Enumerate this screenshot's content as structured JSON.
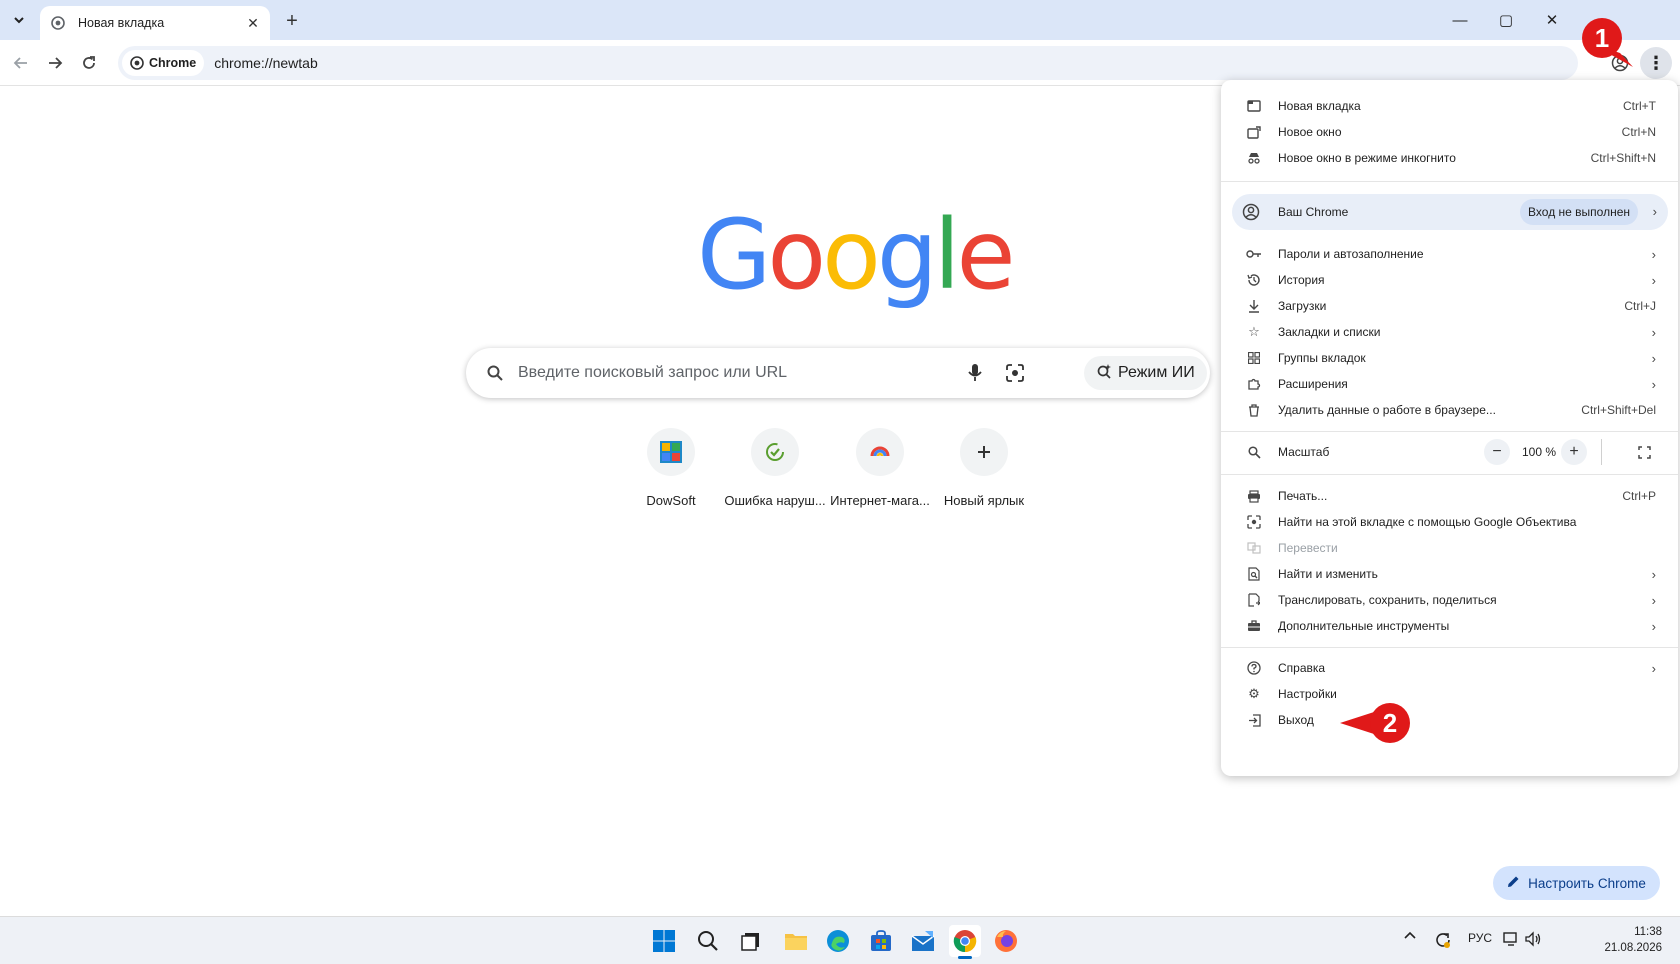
{
  "tab": {
    "title": "Новая вкладка"
  },
  "toolbar": {
    "chip_label": "Chrome",
    "url": "chrome://newtab"
  },
  "google_logo": {
    "letters": [
      "G",
      "o",
      "o",
      "g",
      "l",
      "e"
    ],
    "colors": [
      "#4285F4",
      "#EA4335",
      "#FBBC05",
      "#4285F4",
      "#34A853",
      "#EA4335"
    ]
  },
  "search": {
    "placeholder": "Введите поисковый запрос или URL",
    "ai_mode_label": "Режим ИИ"
  },
  "shortcuts": [
    {
      "label": "DowSoft",
      "icon": "dowsoft-icon"
    },
    {
      "label": "Ошибка наруш...",
      "icon": "checkmark-icon"
    },
    {
      "label": "Интернет-мага...",
      "icon": "rainbow-icon"
    },
    {
      "label": "Новый ярлык",
      "icon": "plus-icon"
    }
  ],
  "customize": {
    "label": "Настроить Chrome"
  },
  "menu": {
    "new_tab": {
      "label": "Новая вкладка",
      "shortcut": "Ctrl+T"
    },
    "new_window": {
      "label": "Новое окно",
      "shortcut": "Ctrl+N"
    },
    "incognito": {
      "label": "Новое окно в режиме инкогнито",
      "shortcut": "Ctrl+Shift+N"
    },
    "your_chrome": {
      "label": "Ваш Chrome",
      "status": "Вход не выполнен"
    },
    "passwords": {
      "label": "Пароли и автозаполнение"
    },
    "history": {
      "label": "История"
    },
    "downloads": {
      "label": "Загрузки",
      "shortcut": "Ctrl+J"
    },
    "bookmarks": {
      "label": "Закладки и списки"
    },
    "tab_groups": {
      "label": "Группы вкладок"
    },
    "extensions": {
      "label": "Расширения"
    },
    "clear_data": {
      "label": "Удалить данные о работе в браузере...",
      "shortcut": "Ctrl+Shift+Del"
    },
    "zoom": {
      "label": "Масштаб",
      "minus": "−",
      "value": "100 %",
      "plus": "+"
    },
    "print": {
      "label": "Печать...",
      "shortcut": "Ctrl+P"
    },
    "lens": {
      "label": "Найти на этой вкладке с помощью Google Объектива"
    },
    "translate": {
      "label": "Перевести"
    },
    "find_edit": {
      "label": "Найти и изменить"
    },
    "cast": {
      "label": "Транслировать, сохранить, поделиться"
    },
    "more_tools": {
      "label": "Дополнительные инструменты"
    },
    "help": {
      "label": "Справка"
    },
    "settings": {
      "label": "Настройки"
    },
    "exit": {
      "label": "Выход"
    }
  },
  "callouts": {
    "one": "1",
    "two": "2",
    "color": "#e01919"
  },
  "taskbar": {
    "lang": "РУС",
    "time": "11:38",
    "date": "21.08.2026"
  }
}
